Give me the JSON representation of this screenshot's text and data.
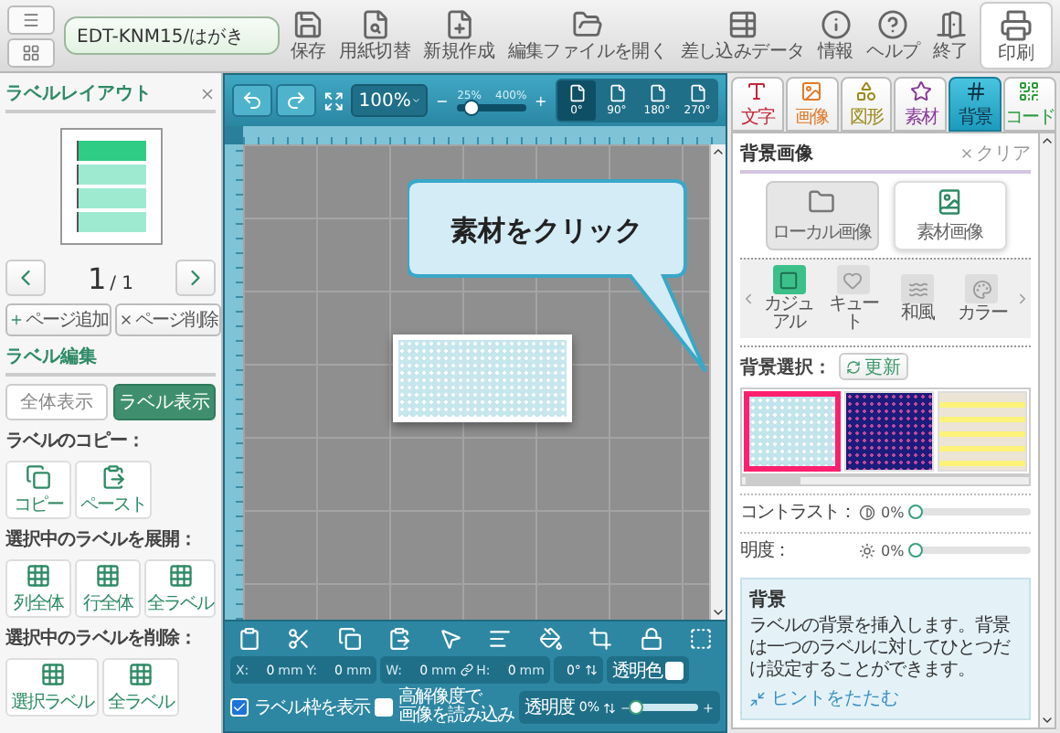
{
  "file_name": "EDT-KNM15/はがき",
  "toolbar": [
    {
      "label": "保存",
      "kind": "save"
    },
    {
      "label": "用紙切替",
      "kind": "paper"
    },
    {
      "label": "新規作成",
      "kind": "new"
    },
    {
      "label": "編集ファイルを開く",
      "kind": "open"
    },
    {
      "label": "差し込みデータ",
      "kind": "merge"
    },
    {
      "label": "情報",
      "kind": "info"
    },
    {
      "label": "ヘルプ",
      "kind": "help"
    },
    {
      "label": "終了",
      "kind": "exit"
    }
  ],
  "print_button": {
    "label": "印刷"
  },
  "layout_panel": {
    "title": "ラベルレイアウト",
    "labels": [
      {
        "selected": true
      },
      {
        "selected": false
      },
      {
        "selected": false
      },
      {
        "selected": false
      }
    ],
    "page_current": "1",
    "page_total": "/ 1",
    "page_buttons": [
      {
        "label": "ページ追加",
        "kind": "add"
      },
      {
        "label": "ページ削除",
        "kind": "delete"
      }
    ],
    "section_title": "ラベル編集",
    "view_toggle": [
      {
        "label": "全体表示",
        "selected": false
      },
      {
        "label": "ラベル表示",
        "selected": true
      }
    ],
    "groups": [
      {
        "title": "ラベルのコピー：",
        "buttons": [
          {
            "label": "コピー",
            "kind": "copy"
          },
          {
            "label": "ペースト",
            "kind": "paste"
          }
        ]
      },
      {
        "title": "選択中のラベルを展開：",
        "buttons": [
          {
            "label": "列全体",
            "kind": "grid"
          },
          {
            "label": "行全体",
            "kind": "grid"
          },
          {
            "label": "全ラベル",
            "kind": "grid"
          }
        ]
      },
      {
        "title": "選択中のラベルを削除：",
        "buttons": [
          {
            "label": "選択ラベル",
            "kind": "grid"
          },
          {
            "label": "全ラベル",
            "kind": "grid"
          }
        ]
      }
    ]
  },
  "canvas": {
    "zoom": "100%",
    "zoom_slider": {
      "min_label": "25%",
      "max_label": "400%",
      "level": 0.2
    },
    "rotations": [
      {
        "label": "0°",
        "selected": true
      },
      {
        "label": "90°",
        "selected": false
      },
      {
        "label": "180°",
        "selected": false
      },
      {
        "label": "270°",
        "selected": false
      }
    ],
    "callout": "素材をクリック",
    "fields": [
      {
        "label": "X:",
        "value": "0",
        "unit": "mm"
      },
      {
        "label": "Y:",
        "value": "0",
        "unit": "mm"
      },
      {
        "label": "W:",
        "value": "0",
        "unit": "mm"
      },
      {
        "label": "H:",
        "value": "0",
        "unit": "mm"
      }
    ],
    "angle": "0°",
    "transparent_color": {
      "label": "透明色",
      "checked": false
    },
    "show_frame": {
      "label": "ラベル枠を表示",
      "checked": true
    },
    "high_res": {
      "label_lines": [
        "高解像度で",
        "画像を読み込み"
      ],
      "checked": false
    },
    "opacity": {
      "label": "透明度",
      "value": "0%",
      "level": 0
    }
  },
  "right_panel": {
    "tabs": [
      {
        "label": "文字",
        "kind": "text",
        "selected": false
      },
      {
        "label": "画像",
        "kind": "image",
        "selected": false
      },
      {
        "label": "図形",
        "kind": "shape",
        "selected": false
      },
      {
        "label": "素材",
        "kind": "material",
        "selected": false
      },
      {
        "label": "背景",
        "kind": "background",
        "selected": true
      },
      {
        "label": "コード",
        "kind": "code",
        "selected": false
      }
    ],
    "title": "背景画像",
    "clear": "クリア",
    "sources": [
      {
        "label": "ローカル画像",
        "kind": "local",
        "selected": false
      },
      {
        "label": "素材画像",
        "kind": "material",
        "selected": true
      }
    ],
    "categories": [
      {
        "label": "カジュアル",
        "kind": "casual",
        "selected": true
      },
      {
        "label": "キュート",
        "kind": "cute",
        "selected": false
      },
      {
        "label": "和風",
        "kind": "japanese",
        "selected": false
      },
      {
        "label": "カラー",
        "kind": "color",
        "selected": false
      }
    ],
    "select_label": "背景選択：",
    "refresh": "更新",
    "patterns": [
      {
        "kind": "dots",
        "selected": true
      },
      {
        "kind": "navy",
        "selected": false
      },
      {
        "kind": "stripes",
        "selected": false
      }
    ],
    "adjustments": [
      {
        "label": "コントラスト：",
        "kind": "contrast",
        "value": "0%",
        "level": 0
      },
      {
        "label": "明度：",
        "kind": "brightness",
        "value": "0%",
        "level": 0
      }
    ],
    "hint": {
      "title": "背景",
      "text": "ラベルの背景を挿入します。背景は一つのラベルに対してひとつだけ設定することができます。",
      "collapse": "ヒントをたたむ"
    }
  }
}
